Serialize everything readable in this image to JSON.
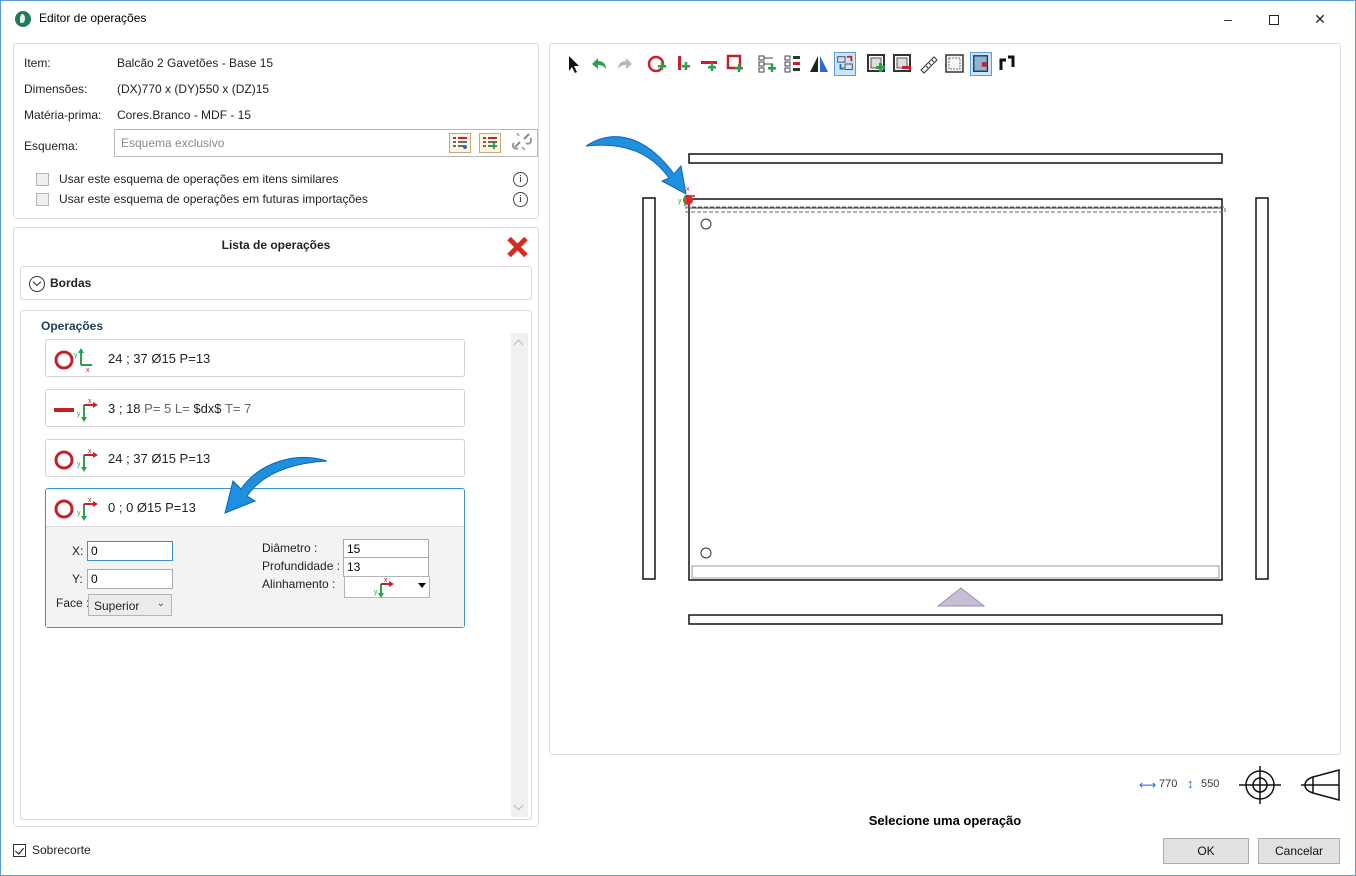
{
  "window": {
    "title": "Editor de operações",
    "controls": {
      "minimize": "–",
      "close": "✕"
    }
  },
  "item_info": {
    "item_label": "Item:",
    "item_value": "Balcão 2 Gavetões - Base 15",
    "dimensions_label": "Dimensões:",
    "dimensions_value": "(DX)770 x (DY)550 x (DZ)15",
    "material_label": "Matéria-prima:",
    "material_value": "Cores.Branco - MDF - 15",
    "scheme_label": "Esquema:",
    "scheme_placeholder": "Esquema exclusivo",
    "checkbox_similar": {
      "label": "Usar este esquema de operações em itens similares",
      "checked": false
    },
    "checkbox_future": {
      "label": "Usar este esquema de operações em futuras importações",
      "checked": false
    },
    "info_glyph": "i"
  },
  "operations_list": {
    "title": "Lista de operações",
    "section_borders": "Bordas",
    "section_operations": "Operações",
    "items": [
      {
        "icon": "circle-drill-icon",
        "text": "24 ; 37 Ø15 P=13",
        "selected": false
      },
      {
        "icon": "line-groove-icon",
        "text_main": "3 ; 18",
        "text_p": "P= 5",
        "text_l_label": "L=",
        "text_l_value": "$dx$",
        "text_t": "T= 7",
        "selected": false
      },
      {
        "icon": "circle-drill-icon",
        "text": "24 ; 37 Ø15 P=13",
        "selected": false
      },
      {
        "icon": "circle-drill-icon",
        "text": "0 ; 0 Ø15 P=13",
        "selected": true
      }
    ],
    "selected_detail": {
      "x_label": "X:",
      "x_value": "0",
      "y_label": "Y:",
      "y_value": "0",
      "face_label": "Face :",
      "face_value": "Superior",
      "diameter_label": "Diâmetro :",
      "diameter_value": "15",
      "depth_label": "Profundidade :",
      "depth_value": "13",
      "alignment_label": "Alinhamento :"
    }
  },
  "toolbar": {
    "tools": [
      "select-arrow-icon",
      "undo-icon",
      "redo-icon",
      "add-hole-icon",
      "add-vertical-groove-icon",
      "add-horizontal-groove-icon",
      "add-pocket-icon",
      "add-hole-pattern-icon",
      "add-row-pattern-icon",
      "mirror-icon",
      "swap-axes-icon",
      "add-rectangle-icon",
      "remove-rectangle-icon",
      "measure-icon",
      "frame-icon",
      "view-toggle-icon",
      "rotate-icon"
    ],
    "active_tools": [
      "swap-axes-icon",
      "view-toggle-icon"
    ]
  },
  "canvas": {
    "dx": "770",
    "dy": "550",
    "axis_x": "x",
    "axis_y": "y"
  },
  "status": {
    "dim_width_value": "770",
    "dim_height_value": "550",
    "message": "Selecione uma operação"
  },
  "footer": {
    "sobrecorte_label": "Sobrecorte",
    "sobrecorte_checked": true,
    "ok_label": "OK",
    "cancel_label": "Cancelar"
  },
  "colors": {
    "accent_blue": "#3e8ed0",
    "drill_red": "#c0232a",
    "axis_green": "#2aa14a",
    "arrow_blue": "#1f8fe0"
  }
}
